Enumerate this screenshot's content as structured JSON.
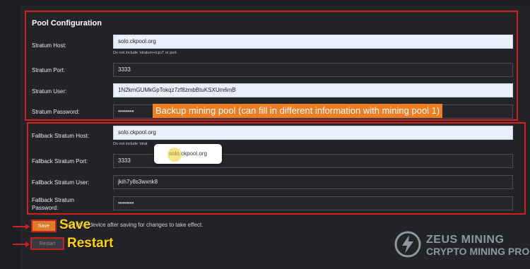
{
  "section": {
    "title": "Pool Configuration"
  },
  "primary": {
    "host_label": "Stratum Host:",
    "host_value": "solo.ckpool.org",
    "host_hint": "Do not include 'stratum+tcp://' or port.",
    "port_label": "Stratum Port:",
    "port_value": "3333",
    "user_label": "Stratum User:",
    "user_value": "1N2kmGUMkGpTokqz7zf8zmbBtuKSXUm6mB",
    "password_label": "Stratum Password:",
    "password_value": "••••••••"
  },
  "callout": {
    "text": "Backup mining pool (can fill in different information with mining pool 1)"
  },
  "fallback": {
    "host_label": "Fallback Stratum Host:",
    "host_value": "solo.ckpool.org",
    "host_hint": "Do not include 'strat",
    "port_label": "Fallback Stratum Port:",
    "port_value": "3333",
    "user_label": "Fallback Stratum User:",
    "user_value": "jkih7y8s3wxnk8",
    "password_label_1": "Fallback Stratum",
    "password_label_2": "Password:",
    "password_value": "••••••••"
  },
  "autocomplete": {
    "suggestion": "solo.ckpool.org"
  },
  "footer": {
    "note": "start this device after saving for changes to take effect."
  },
  "buttons": {
    "save": "Save",
    "restart": "Restart"
  },
  "annotations": {
    "save": "Save",
    "restart": "Restart"
  },
  "logo": {
    "line1": "ZEUS MINING",
    "line2": "CRYPTO MINING PRO"
  },
  "colors": {
    "accent_orange": "#e07b27",
    "highlight_red": "#d3201f",
    "annotation_yellow": "#ffd400"
  }
}
